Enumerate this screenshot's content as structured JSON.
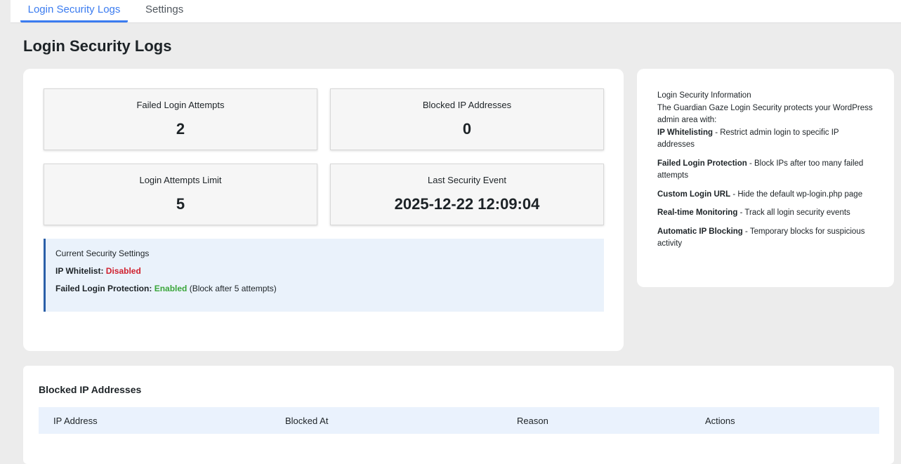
{
  "tabs": [
    "Login Security Logs",
    "Settings"
  ],
  "page_title": "Login Security Logs",
  "stats": [
    {
      "label": "Failed Login Attempts",
      "value": "2"
    },
    {
      "label": "Blocked IP Addresses",
      "value": "0"
    },
    {
      "label": "Login Attempts Limit",
      "value": "5"
    },
    {
      "label": "Last Security Event",
      "value": "2025-12-22 12:09:04"
    }
  ],
  "settings": {
    "title": "Current Security Settings",
    "whitelist_label": "IP Whitelist:",
    "whitelist_value": "Disabled",
    "protection_label": "Failed Login Protection:",
    "protection_value": "Enabled",
    "protection_note": "(Block after 5 attempts)"
  },
  "info": {
    "title": "Login Security Information",
    "intro": "The Guardian Gaze Login Security protects your WordPress admin area with:",
    "features": [
      {
        "name": "IP Whitelisting",
        "desc": " - Restrict admin login to specific IP addresses"
      },
      {
        "name": "Failed Login Protection",
        "desc": " - Block IPs after too many failed attempts"
      },
      {
        "name": "Custom Login URL",
        "desc": " - Hide the default wp-login.php page"
      },
      {
        "name": "Real-time Monitoring",
        "desc": " - Track all login security events"
      },
      {
        "name": "Automatic IP Blocking",
        "desc": " - Temporary blocks for suspicious activity"
      }
    ]
  },
  "blocked": {
    "title": "Blocked IP Addresses",
    "columns": [
      "IP Address",
      "Blocked At",
      "Reason",
      "Actions"
    ]
  },
  "colors": {
    "accent": "#3b7cf0",
    "disabled": "#d0202e",
    "enabled": "#3aa63a"
  }
}
